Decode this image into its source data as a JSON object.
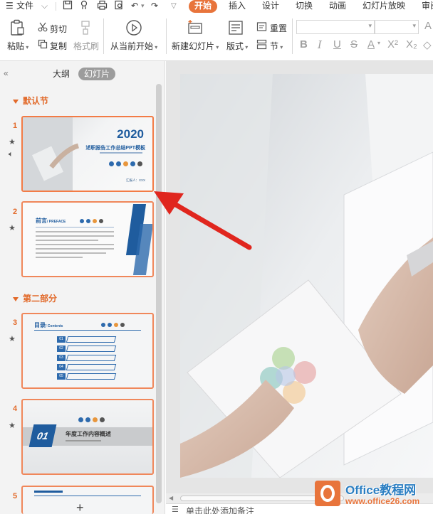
{
  "menubar": {
    "file": "文件",
    "tabs": [
      "开始",
      "插入",
      "设计",
      "切换",
      "动画",
      "幻灯片放映",
      "审阅"
    ],
    "active_tab": "开始"
  },
  "ribbon": {
    "paste": "粘贴",
    "cut": "剪切",
    "copy": "复制",
    "format_painter": "格式刷",
    "from_current": "从当前开始",
    "new_slide": "新建幻灯片",
    "layout": "版式",
    "reset": "重置",
    "section": "节",
    "colors": {
      "accent": "#e8743b",
      "icon": "#555555",
      "disabled": "#a0a0a0"
    }
  },
  "panel": {
    "tab_outline": "大纲",
    "tab_slides": "幻灯片",
    "sections": [
      {
        "label": "默认节"
      },
      {
        "label": "第二部分"
      }
    ],
    "slides": [
      {
        "num": "1",
        "year": "2020",
        "title": "述职报告工作总结PPT模板",
        "sub": "Write your title here",
        "footer": "汇报人：XXX"
      },
      {
        "num": "2",
        "title": "前言",
        "title_en": "/ PREFACE"
      },
      {
        "num": "3",
        "title": "目录",
        "title_en": "/ Contents",
        "items": [
          "01",
          "02",
          "03",
          "04",
          "05"
        ]
      },
      {
        "num": "4",
        "badge": "01",
        "title": "年度工作内容概述"
      },
      {
        "num": "5"
      }
    ],
    "add_button": "+"
  },
  "notes": {
    "placeholder": "单击此处添加备注"
  },
  "watermark": {
    "brand": "Office教程网",
    "url": "www.office26.com"
  }
}
